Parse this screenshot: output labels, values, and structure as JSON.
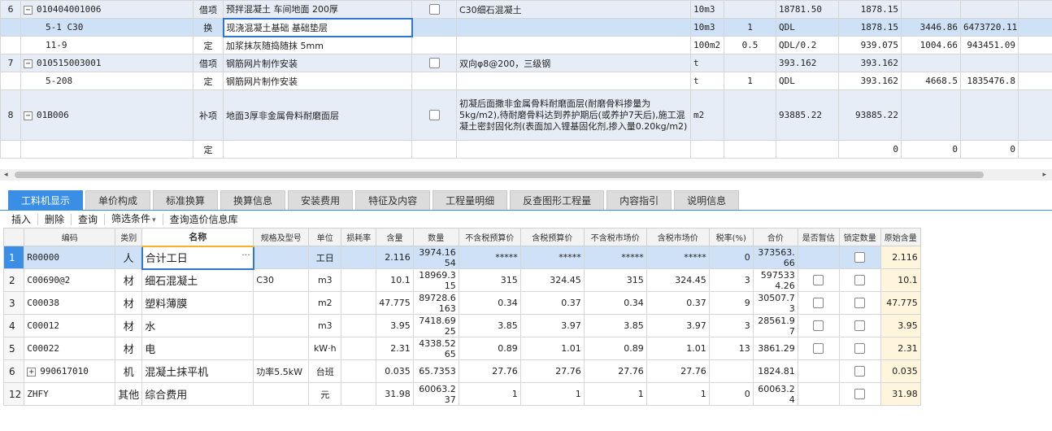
{
  "top_rows": [
    {
      "no": "6",
      "code": "010404001006",
      "tog": "−",
      "type": "借项",
      "name": "预拌混凝土 车间地面 200厚",
      "checkbox": true,
      "feature": "C30细石混凝土",
      "unit": "10m3",
      "qty": "",
      "expr": "18781.50",
      "qty2": "1878.15",
      "price": "",
      "total": "",
      "kind": "item"
    },
    {
      "no": "",
      "code": "5-1 C30",
      "tog": "",
      "type": "换",
      "name": "现浇混凝土基础 基础垫层",
      "checkbox": false,
      "feature": "",
      "unit": "10m3",
      "qty": "1",
      "expr": "QDL",
      "qty2": "1878.15",
      "price": "3446.86",
      "total": "6473720.11",
      "kind": "sel"
    },
    {
      "no": "",
      "code": "11-9",
      "tog": "",
      "type": "定",
      "name": "加浆抹灰随捣随抹 5mm",
      "checkbox": false,
      "feature": "",
      "unit": "100m2",
      "qty": "0.5",
      "expr": "QDL/0.2",
      "qty2": "939.075",
      "price": "1004.66",
      "total": "943451.09",
      "kind": "sub"
    },
    {
      "no": "7",
      "code": "010515003001",
      "tog": "−",
      "type": "借项",
      "name": "钢筋网片制作安装",
      "checkbox": true,
      "feature": "双向φ8@200，三级钢",
      "unit": "t",
      "qty": "",
      "expr": "393.162",
      "qty2": "393.162",
      "price": "",
      "total": "",
      "kind": "item"
    },
    {
      "no": "",
      "code": "5-208",
      "tog": "",
      "type": "定",
      "name": "钢筋网片制作安装",
      "checkbox": false,
      "feature": "",
      "unit": "t",
      "qty": "1",
      "expr": "QDL",
      "qty2": "393.162",
      "price": "4668.5",
      "total": "1835476.8",
      "kind": "sub"
    },
    {
      "no": "8",
      "code": "01B006",
      "tog": "−",
      "type": "补项",
      "name": "地面3厚非金属骨料耐磨面层",
      "checkbox": true,
      "feature": "初凝后面撒非金属骨料耐磨面层(耐磨骨料掺量为5kg/m2),待耐磨骨料达到养护期后(或养护7天后),施工混凝土密封固化剂(表面加入锂基固化剂,掺入量0.20kg/m2)",
      "unit": "m2",
      "qty": "",
      "expr": "93885.22",
      "qty2": "93885.22",
      "price": "",
      "total": "",
      "kind": "item"
    },
    {
      "no": "",
      "code": "",
      "tog": "",
      "type": "定",
      "name": "",
      "checkbox": false,
      "feature": "",
      "unit": "",
      "qty": "",
      "expr": "",
      "qty2": "0",
      "price": "0",
      "total": "0",
      "kind": "sub"
    }
  ],
  "tabs": [
    "工料机显示",
    "单价构成",
    "标准换算",
    "换算信息",
    "安装费用",
    "特征及内容",
    "工程量明细",
    "反查图形工程量",
    "内容指引",
    "说明信息"
  ],
  "toolbar": {
    "insert": "插入",
    "delete": "删除",
    "query": "查询",
    "filter": "筛选条件",
    "filter_arrow": "▾",
    "query_price": "查询造价信息库"
  },
  "bottom_headers": [
    "",
    "编码",
    "类别",
    "名称",
    "规格及型号",
    "单位",
    "损耗率",
    "含量",
    "数量",
    "不含税预算价",
    "含税预算价",
    "不含税市场价",
    "含税市场价",
    "税率(%)",
    "合价",
    "是否暂估",
    "锁定数量",
    "原始含量"
  ],
  "bottom_rows": [
    {
      "rn": "1",
      "code": "R00000",
      "plus": false,
      "cat": "人",
      "name": "合计工日",
      "dots": "···",
      "spec": "",
      "unit": "工日",
      "loss": "",
      "content": "2.116",
      "amount": "3974.1654",
      "p1": "*****",
      "p2": "*****",
      "p3": "*****",
      "p4": "*****",
      "tax": "0",
      "total": "373563.66",
      "est": false,
      "lock": true,
      "orig": "2.116",
      "sel": true
    },
    {
      "rn": "2",
      "code": "C00690@2",
      "plus": false,
      "cat": "材",
      "name": "细石混凝土",
      "dots": "",
      "spec": "C30",
      "unit": "m3",
      "loss": "",
      "content": "10.1",
      "amount": "18969.315",
      "p1": "315",
      "p2": "324.45",
      "p3": "315",
      "p4": "324.45",
      "tax": "3",
      "total": "5975334.26",
      "est": true,
      "lock": true,
      "orig": "10.1",
      "sel": false
    },
    {
      "rn": "3",
      "code": "C00038",
      "plus": false,
      "cat": "材",
      "name": "塑料薄膜",
      "dots": "",
      "spec": "",
      "unit": "m2",
      "loss": "",
      "content": "47.775",
      "amount": "89728.6163",
      "p1": "0.34",
      "p2": "0.37",
      "p3": "0.34",
      "p4": "0.37",
      "tax": "9",
      "total": "30507.73",
      "est": true,
      "lock": true,
      "orig": "47.775",
      "sel": false
    },
    {
      "rn": "4",
      "code": "C00012",
      "plus": false,
      "cat": "材",
      "name": "水",
      "dots": "",
      "spec": "",
      "unit": "m3",
      "loss": "",
      "content": "3.95",
      "amount": "7418.6925",
      "p1": "3.85",
      "p2": "3.97",
      "p3": "3.85",
      "p4": "3.97",
      "tax": "3",
      "total": "28561.97",
      "est": true,
      "lock": true,
      "orig": "3.95",
      "sel": false
    },
    {
      "rn": "5",
      "code": "C00022",
      "plus": false,
      "cat": "材",
      "name": "电",
      "dots": "",
      "spec": "",
      "unit": "kW·h",
      "loss": "",
      "content": "2.31",
      "amount": "4338.5265",
      "p1": "0.89",
      "p2": "1.01",
      "p3": "0.89",
      "p4": "1.01",
      "tax": "13",
      "total": "3861.29",
      "est": true,
      "lock": true,
      "orig": "2.31",
      "sel": false
    },
    {
      "rn": "6",
      "code": "990617010",
      "plus": true,
      "cat": "机",
      "name": "混凝土抹平机",
      "dots": "",
      "spec": "功率5.5kW",
      "unit": "台班",
      "loss": "",
      "content": "0.035",
      "amount": "65.7353",
      "p1": "27.76",
      "p2": "27.76",
      "p3": "27.76",
      "p4": "27.76",
      "tax": "",
      "total": "1824.81",
      "est": false,
      "lock": true,
      "orig": "0.035",
      "sel": false
    },
    {
      "rn": "12",
      "code": "ZHFY",
      "plus": false,
      "cat": "其他",
      "name": "综合费用",
      "dots": "",
      "spec": "",
      "unit": "元",
      "loss": "",
      "content": "31.98",
      "amount": "60063.237",
      "p1": "1",
      "p2": "1",
      "p3": "1",
      "p4": "1",
      "tax": "0",
      "total": "60063.24",
      "est": false,
      "lock": true,
      "orig": "31.98",
      "sel": false
    }
  ],
  "scroll": {
    "left": "◂",
    "right": "▸"
  },
  "icons": {
    "collapse": "minus-icon",
    "expand": "plus-icon",
    "more": "ellipsis-icon",
    "dropdown": "chevron-down-icon"
  }
}
